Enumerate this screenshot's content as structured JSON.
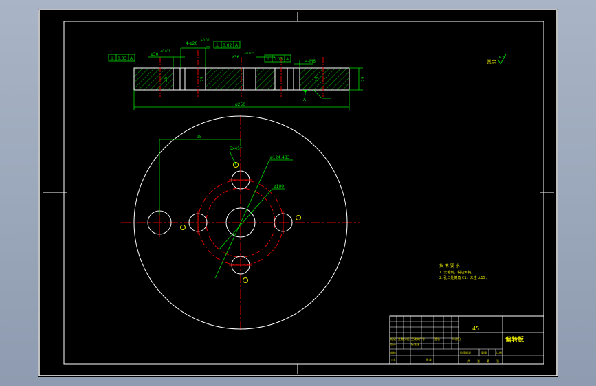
{
  "drawing": {
    "part_name": "偏转板",
    "material": "45",
    "colors": {
      "background": "#000000",
      "outline": "#ffffff",
      "dimension": "#00e000",
      "center_line": "#e00000",
      "hatch": "#00c000",
      "title_text": "#e8e800"
    }
  },
  "section_view": {
    "tol_box_1": {
      "symbol": "⊥",
      "value": "0.03",
      "datum": "A"
    },
    "tol_box_2": {
      "symbol": "⊥",
      "value": "0.02",
      "datum": "A"
    },
    "tol_box_3": {
      "symbol": "⊥",
      "value": "0.03",
      "datum": "A"
    },
    "dim_hole_left": "ø30",
    "dim_hole_left_tol": "+0.021",
    "dim_holes_top": "4-ø20",
    "dim_holes_top_tol": "+0.021",
    "dim_bore_center": "ø36",
    "dim_bore_center_tol": "+0.025",
    "dim_thread": "4-M6",
    "dim_thickness": "25",
    "dim_overall_diameter": "ø250",
    "datum_label": "A",
    "roughness_note": "其余",
    "roughness_value": "6.3",
    "vertical_dims": [
      "25",
      "25",
      "25"
    ]
  },
  "plan_view": {
    "dim_offset": "95",
    "dim_angle": "5x45°",
    "dim_pcd_large": "ø124.483",
    "dim_pcd_small": "ø100"
  },
  "technical_requirements": {
    "title": "技 术 要 求",
    "items": [
      "1. 去毛刺，锐边倒钝。",
      "2. 孔口处倒角 C1，未注 ±15 。"
    ]
  },
  "title_block": {
    "revision_cells": [
      "标记",
      "处数",
      "分区",
      "更改文件号",
      "签名",
      "年月日"
    ],
    "role_cells": [
      "设计",
      "标准化",
      "审核",
      "工艺",
      "批准"
    ],
    "stage_label": "阶段标记",
    "weight_label": "重量",
    "scale_label": "比例",
    "sheet_cells": [
      "共",
      "张",
      "第",
      "张"
    ]
  }
}
